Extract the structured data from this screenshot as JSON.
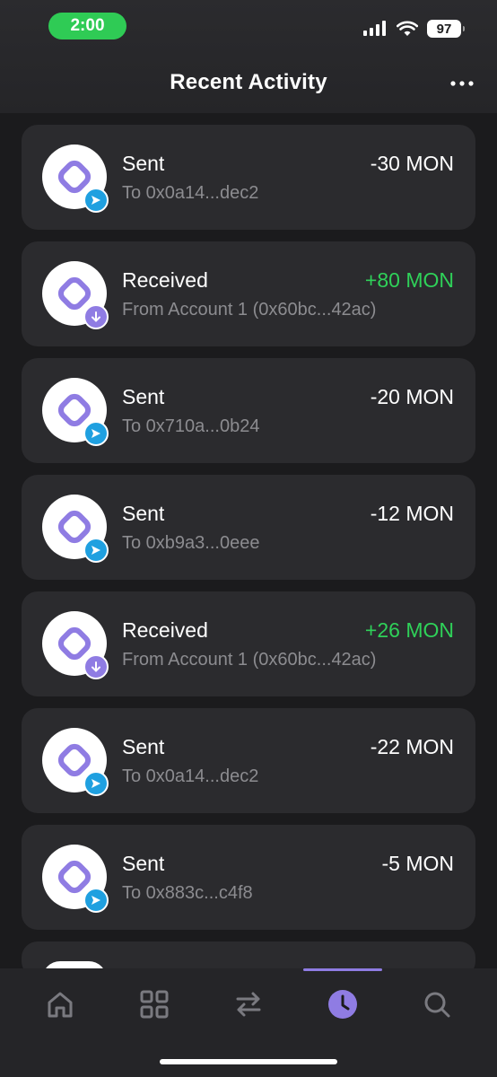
{
  "status_bar": {
    "time": "2:00",
    "battery": "97"
  },
  "header": {
    "title": "Recent Activity"
  },
  "colors": {
    "accent": "#8f7ce3",
    "sent_badge": "#1fa0e0",
    "received_badge": "#8f7ce3",
    "positive_amount": "#2fd159",
    "status_pill": "#2fcb55"
  },
  "activity": [
    {
      "kind": "sent",
      "type": "Sent",
      "peer": "To 0x0a14...dec2",
      "amount": "-30 MON"
    },
    {
      "kind": "received",
      "type": "Received",
      "peer": "From Account 1 (0x60bc...42ac)",
      "amount": "+80 MON"
    },
    {
      "kind": "sent",
      "type": "Sent",
      "peer": "To 0x710a...0b24",
      "amount": "-20 MON"
    },
    {
      "kind": "sent",
      "type": "Sent",
      "peer": "To 0xb9a3...0eee",
      "amount": "-12 MON"
    },
    {
      "kind": "received",
      "type": "Received",
      "peer": "From Account 1 (0x60bc...42ac)",
      "amount": "+26 MON"
    },
    {
      "kind": "sent",
      "type": "Sent",
      "peer": "To 0x0a14...dec2",
      "amount": "-22 MON"
    },
    {
      "kind": "sent",
      "type": "Sent",
      "peer": "To 0x883c...c4f8",
      "amount": "-5 MON"
    }
  ],
  "tabbar": {
    "tabs": [
      {
        "icon": "home-icon",
        "active": false
      },
      {
        "icon": "grid-icon",
        "active": false
      },
      {
        "icon": "swap-icon",
        "active": false
      },
      {
        "icon": "history-clock-icon",
        "active": true
      },
      {
        "icon": "search-icon",
        "active": false
      }
    ]
  }
}
